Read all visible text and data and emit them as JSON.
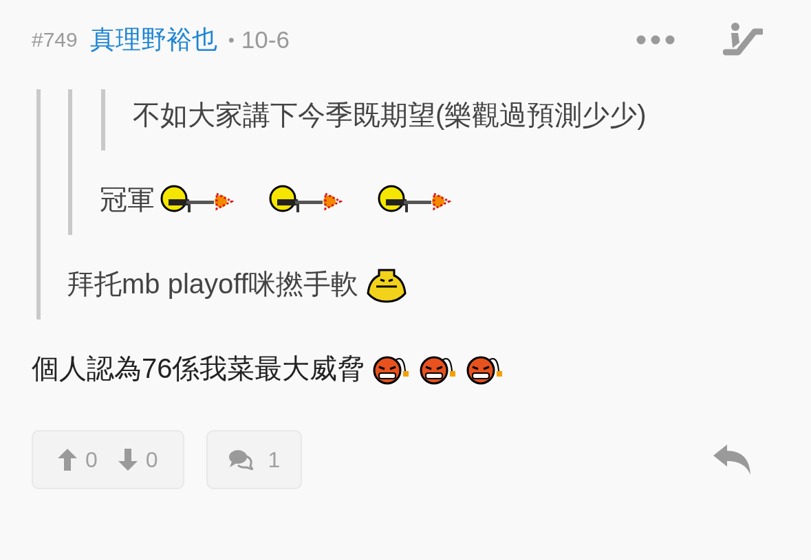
{
  "post": {
    "number": "#749",
    "author": "真理野裕也",
    "separator": "•",
    "date": "10-6",
    "quote": {
      "content": [
        {
          "kind": "text",
          "text": "拜托mb playoff咪撚手軟"
        },
        {
          "kind": "sweat"
        }
      ],
      "quote": {
        "content": [
          {
            "kind": "text",
            "text": "冠軍"
          },
          {
            "kind": "shooter"
          },
          {
            "kind": "shooter"
          },
          {
            "kind": "shooter"
          }
        ],
        "quote": {
          "content": [
            {
              "kind": "text",
              "text": "不如大家講下今季既期望(樂觀過預測少少)"
            }
          ]
        }
      }
    },
    "content": [
      {
        "kind": "text",
        "text": "個人認為76係我菜最大威脅"
      },
      {
        "kind": "bomb"
      },
      {
        "kind": "bomb"
      },
      {
        "kind": "bomb"
      }
    ],
    "votes": {
      "up": "0",
      "down": "0"
    },
    "comments": "1"
  }
}
